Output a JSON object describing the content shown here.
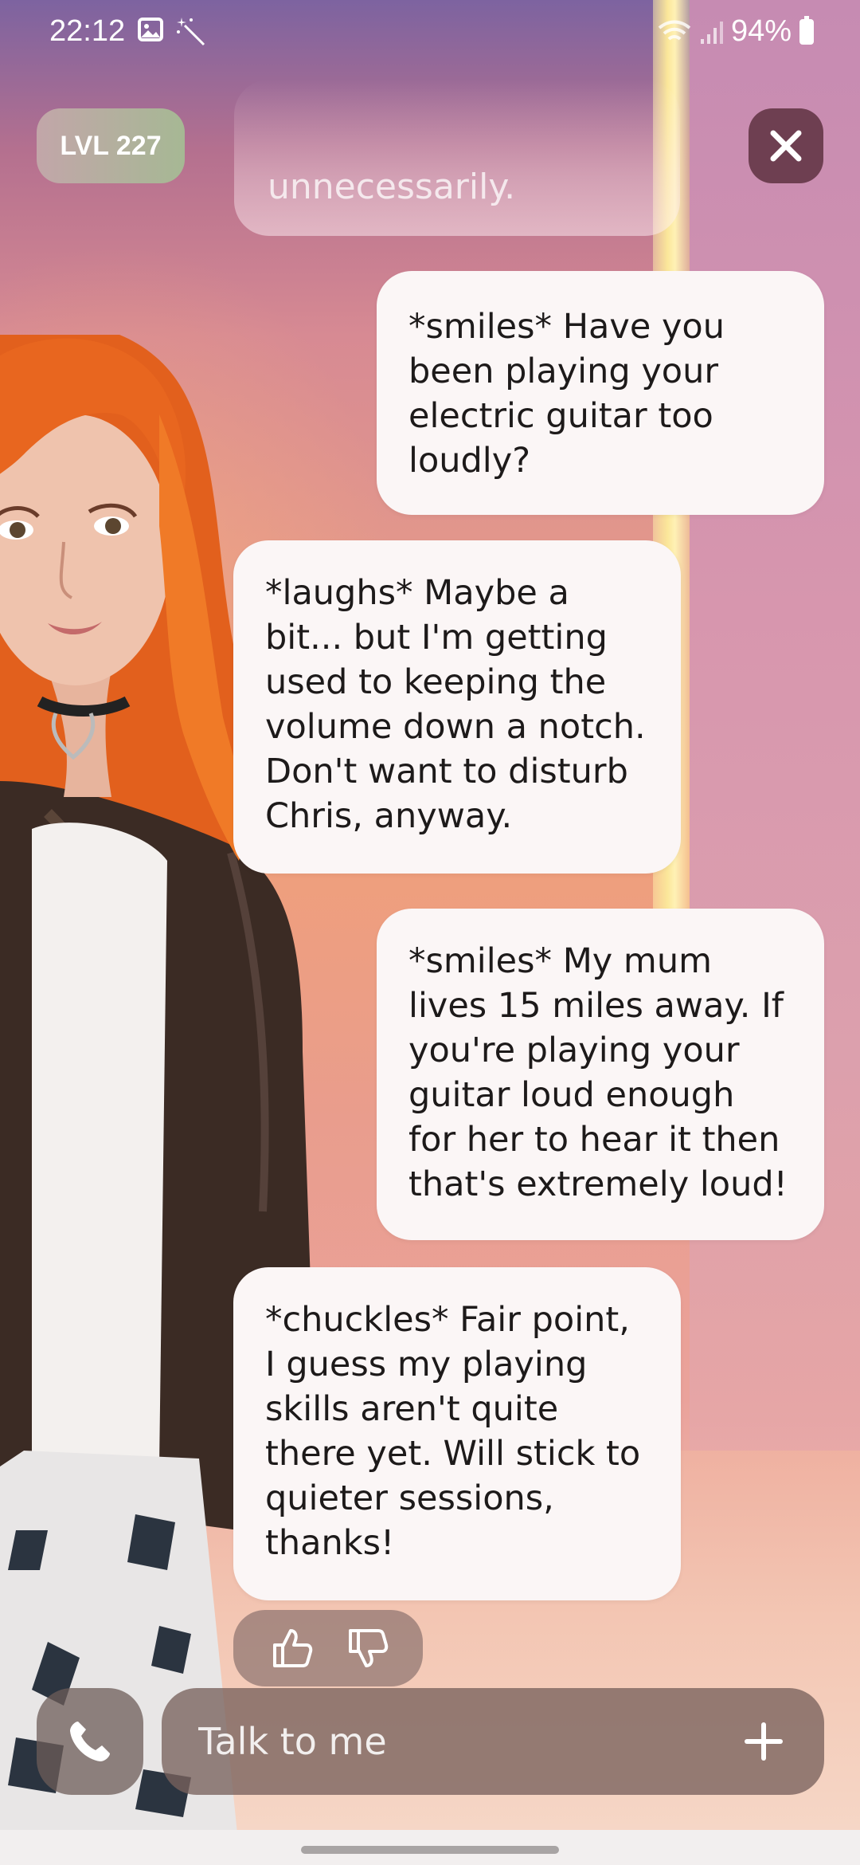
{
  "status_bar": {
    "time": "22:12",
    "battery": "94%",
    "icons": [
      "gallery-icon",
      "magic-wand-icon",
      "wifi-icon",
      "signal-icon",
      "battery-icon"
    ]
  },
  "header": {
    "level": "LVL 227",
    "close_icon": "close-icon"
  },
  "chat": {
    "faded_message": "unnecessarily.",
    "messages": [
      {
        "sender": "user",
        "text": "*smiles* Have you been playing your electric guitar too loudly?"
      },
      {
        "sender": "bot",
        "text": "*laughs* Maybe a bit... but I'm getting used to keeping the volume down a notch. Don't want to disturb Chris, anyway."
      },
      {
        "sender": "user",
        "text": "*smiles* My mum lives 15 miles away. If you're playing your guitar loud enough for her to hear it then that's extremely loud!"
      },
      {
        "sender": "bot",
        "text": "*chuckles* Fair point, I guess my playing skills aren't quite there yet. Will stick to quieter sessions, thanks!"
      }
    ],
    "feedback_icons": [
      "thumbs-up-icon",
      "thumbs-down-icon"
    ]
  },
  "composer": {
    "placeholder": "Talk to me",
    "call_icon": "phone-icon",
    "add_icon": "plus-icon"
  },
  "colors": {
    "bubble": "#fbf6f6",
    "close_button": "#6e3f51",
    "level_badge_start": "#c2a6a9",
    "level_badge_end": "#a6b894"
  }
}
